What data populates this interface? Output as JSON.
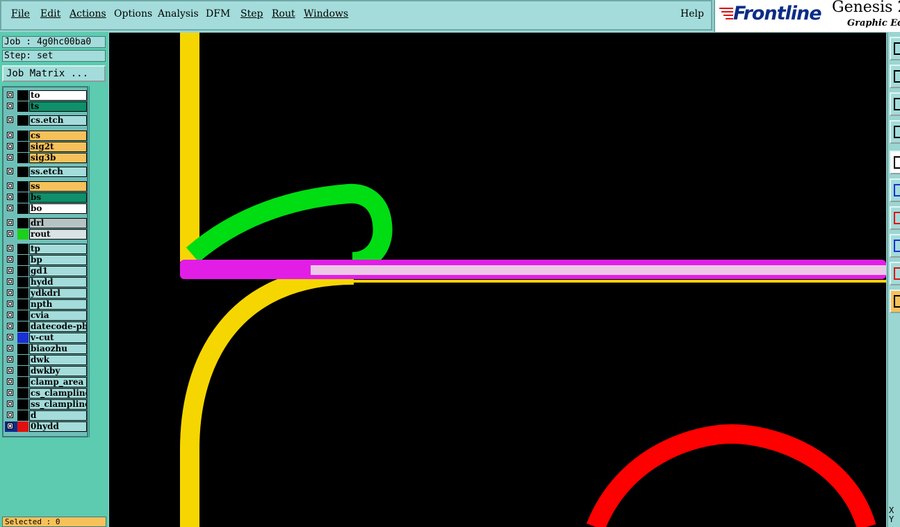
{
  "menu": [
    "File",
    "Edit",
    "Actions",
    "Options",
    "Analysis",
    "DFM",
    "Step",
    "Rout",
    "Windows"
  ],
  "help_label": "Help",
  "brand": {
    "logo": "Frontline",
    "app": "Genesis 2",
    "subtitle": "Graphic Edit"
  },
  "job": {
    "job_line": "Job : 4g0hc00ba0",
    "step_line": "Step: set",
    "matrix_button": "Job Matrix ..."
  },
  "layers": [
    {
      "name": "to",
      "bg": "#ffffff"
    },
    {
      "name": "ts",
      "bg": "#0f8f6a"
    },
    {
      "name": "cs.etch",
      "bg": "#a3dcda"
    },
    {
      "name": "cs",
      "bg": "#f6c15a"
    },
    {
      "name": "sig2t",
      "bg": "#f6c15a"
    },
    {
      "name": "sig3b",
      "bg": "#f6c15a"
    },
    {
      "name": "ss.etch",
      "bg": "#a3dcda"
    },
    {
      "name": "ss",
      "bg": "#f6c15a"
    },
    {
      "name": "bs",
      "bg": "#0f8f6a"
    },
    {
      "name": "bo",
      "bg": "#ffffff"
    },
    {
      "name": "drl",
      "bg": "#b6c3c3"
    },
    {
      "name": "rout",
      "bg": "#d9e3e3"
    },
    {
      "name": "tp",
      "bg": "#a3dcda"
    },
    {
      "name": "bp",
      "bg": "#a3dcda"
    },
    {
      "name": "gd1",
      "bg": "#a3dcda"
    },
    {
      "name": "hydd",
      "bg": "#a3dcda"
    },
    {
      "name": "ydkdrl",
      "bg": "#a3dcda"
    },
    {
      "name": "npth",
      "bg": "#a3dcda"
    },
    {
      "name": "cvia",
      "bg": "#a3dcda"
    },
    {
      "name": "datecode-pbe",
      "bg": "#a3dcda"
    },
    {
      "name": "v-cut",
      "bg": "#a3dcda"
    },
    {
      "name": "biaozhu",
      "bg": "#a3dcda"
    },
    {
      "name": "dwk",
      "bg": "#a3dcda"
    },
    {
      "name": "dwkby",
      "bg": "#a3dcda"
    },
    {
      "name": "clamp_area",
      "bg": "#a3dcda"
    },
    {
      "name": "cs_clampline",
      "bg": "#a3dcda"
    },
    {
      "name": "ss_clampline",
      "bg": "#a3dcda"
    },
    {
      "name": "d",
      "bg": "#a3dcda"
    },
    {
      "name": "0hydd",
      "bg": "#a3dcda"
    }
  ],
  "layer_swatches": {
    "rout": "#1bcf1b",
    "v-cut": "#1a2fd6",
    "0hydd": "#e01010"
  },
  "selected_label": "Selected : 0",
  "xy": {
    "x_label": "X",
    "y_label": "Y"
  },
  "colors": {
    "yellow": "#f6d600",
    "green": "#00dd12",
    "magenta": "#e21ee6",
    "pink": "#ecc8e6",
    "red": "#ff0000"
  }
}
